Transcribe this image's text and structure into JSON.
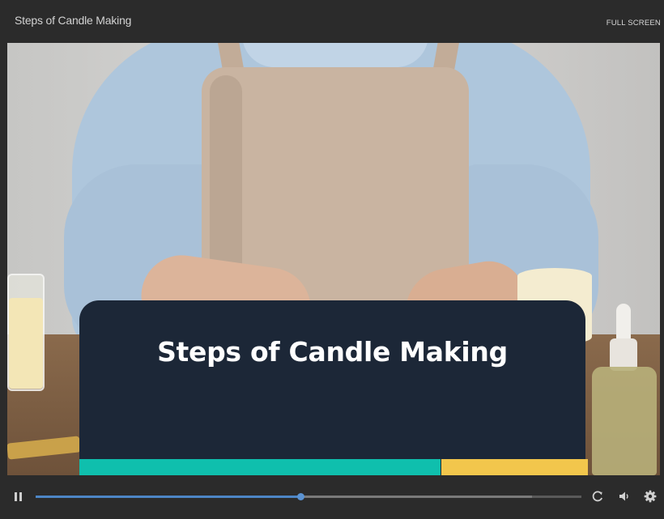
{
  "header": {
    "title": "Steps of Candle Making",
    "fullscreen_label": "FULL SCREEN"
  },
  "slide": {
    "caption": "Steps of Candle Making",
    "image_description": "",
    "colors": {
      "card": "#1c2737",
      "teal": "#0fbfad",
      "yellow": "#f2c64c"
    }
  },
  "player": {
    "state": "playing",
    "progress_fraction": 0.485,
    "buffered_fraction": 0.91,
    "icons": [
      "pause-icon",
      "replay-icon",
      "volume-icon",
      "settings-icon"
    ],
    "accent_color": "#4d86c6"
  }
}
